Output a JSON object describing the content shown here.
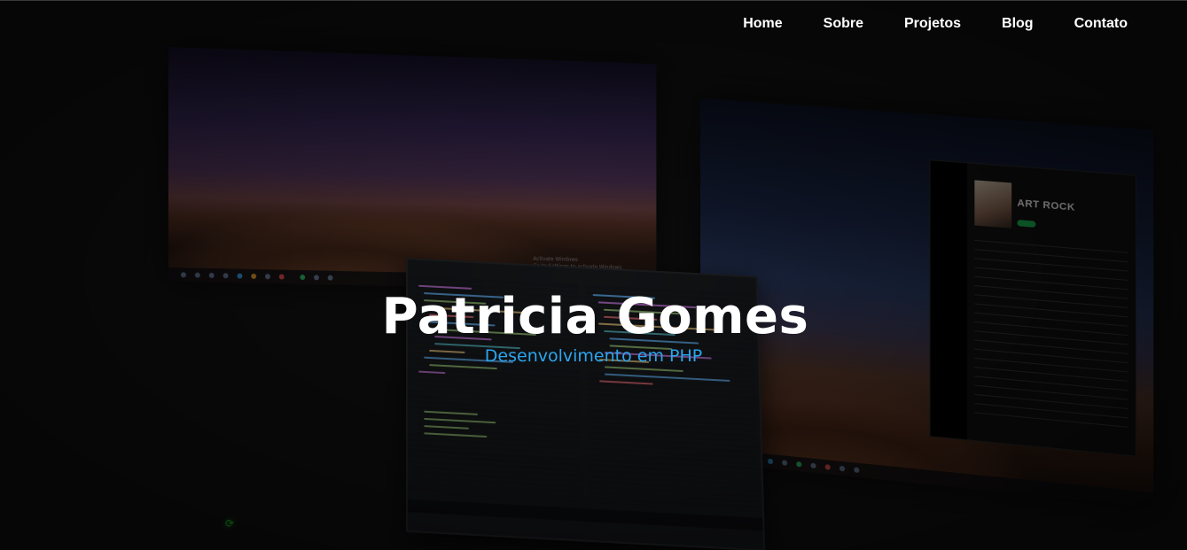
{
  "nav": {
    "items": [
      {
        "label": "Home"
      },
      {
        "label": "Sobre"
      },
      {
        "label": "Projetos"
      },
      {
        "label": "Blog"
      },
      {
        "label": "Contato"
      }
    ]
  },
  "hero": {
    "title": "Patricia Gomes",
    "subtitle": "Desenvolvimento em PHP",
    "background_image": "desk setup with three screens: desert dune wallpaper, music player, code editor"
  },
  "background_screens": {
    "music_player": {
      "playlist_title": "ART ROCK"
    },
    "watermark": {
      "line1": "Activate Windows",
      "line2": "Go to Settings to activate Windows."
    }
  },
  "colors": {
    "background": "#141414",
    "nav_text": "#ffffff",
    "title": "#ffffff",
    "subtitle": "#2ba6f0"
  }
}
